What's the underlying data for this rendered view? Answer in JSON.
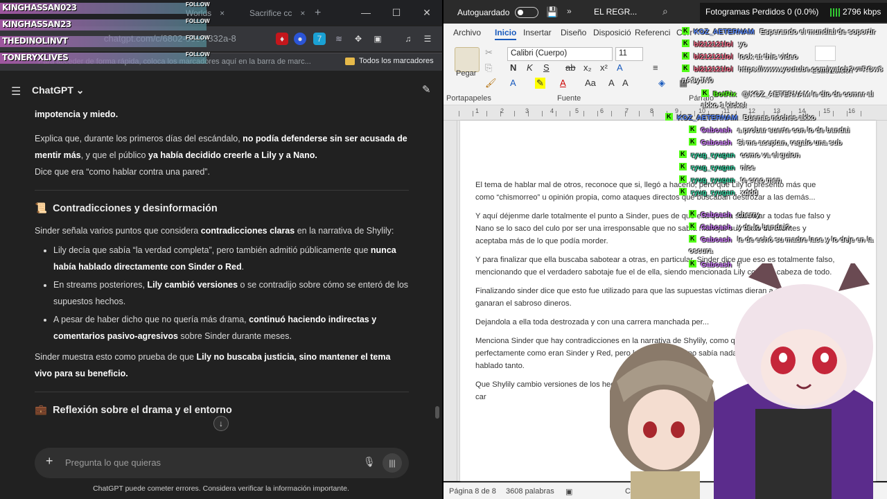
{
  "followers": [
    {
      "name": "KINGHASSAN023",
      "label": "FOLLOW"
    },
    {
      "name": "KINGHASSAN23",
      "label": "FOLLOW"
    },
    {
      "name": "THEDINOLINVT",
      "label": "FOLLOW"
    },
    {
      "name": "TONERYXLIVES",
      "label": "FOLLOW"
    }
  ],
  "browser": {
    "tabs": [
      {
        "label": "Worlds",
        "close": "×"
      },
      {
        "label": "Sacrifice cc",
        "close": "×"
      }
    ],
    "new_tab": "+",
    "window_buttons": [
      "—",
      "☐",
      "✕"
    ],
    "url": "chatgpt.com/c/6802-53c4-832a-8",
    "bookmarks_hint": "Para acceder de forma rápida, coloca los marcadores aquí en la barra de marc...",
    "all_bookmarks": "Todos los marcadores"
  },
  "chatgpt": {
    "title": "ChatGPT",
    "chevron": "⌄",
    "intro_bold": "impotencia y miedo.",
    "para1_a": "Explica que, durante los primeros días del escándalo, ",
    "para1_b": "no podía defenderse sin ser acusada de mentir más",
    "para1_c": ", y que el público ",
    "para1_d": "ya había decidido creerle a Lily y a Nano.",
    "para1_e": "Dice que era “como hablar contra una pared”.",
    "section1": {
      "emoji": "📜",
      "title": "Contradicciones y desinformación"
    },
    "section1_intro_a": "Sinder señala varios puntos que considera ",
    "section1_intro_b": "contradicciones claras",
    "section1_intro_c": " en la narrativa de Shylily:",
    "bullets": [
      {
        "a": "Lily decía que sabía “la verdad completa”, pero también admitió públicamente que ",
        "b": "nunca había hablado directamente con Sinder o Red",
        "c": "."
      },
      {
        "a": "En streams posteriores, ",
        "b": "Lily cambió versiones",
        "c": " o se contradijo sobre cómo se enteró de los supuestos hechos."
      },
      {
        "a": "A pesar de haber dicho que no quería más drama, ",
        "b": "continuó haciendo indirectas y comentarios pasivo-agresivos",
        "c": " sobre Sinder durante meses."
      }
    ],
    "closing_a": "Sinder muestra esto como prueba de que ",
    "closing_b": "Lily no buscaba justicia, sino mantener el tema vivo para su beneficio.",
    "section2": {
      "emoji": "💼",
      "title": "Reflexión sobre el drama y el entorno"
    },
    "composer_placeholder": "Pregunta lo que quieras",
    "disclaimer": "ChatGPT puede cometer errores. Considera verificar la información importante."
  },
  "word": {
    "autosave_label": "Autoguardado",
    "doc_name": "EL REGR...",
    "ribbon_tabs": [
      "Archivo",
      "Inicio",
      "Insertar",
      "Diseño",
      "Disposició",
      "Referenci",
      "Corr"
    ],
    "active_tab": "Inicio",
    "paste_label": "Pegar",
    "font_name": "Calibri (Cuerpo)",
    "font_size": "11",
    "groups": [
      "Portapapeles",
      "Fuente",
      "Párrafo",
      "Estilos",
      "Edición"
    ],
    "ruler_numbers": [
      "1",
      "2",
      "3",
      "4",
      "5",
      "6",
      "7",
      "8",
      "9",
      "10",
      "11",
      "12",
      "13",
      "14",
      "15",
      "16"
    ],
    "paragraphs": [
      "El tema de hablar mal de otros, reconoce que si, llegó a hacerlo, pero que Lily lo presento más que como “chismorreo” u opinión propia, como ataques directos que buscaban destrozar a las demás...",
      "Y aquí déjenme darle totalmente el punto a Sinder, pues de que ella quería sabotear a todas fue falso y Nano se lo saco del culo por ser una irresponsable que no sabía manejar sus listas de clientes y aceptaba más de lo que podía morder.",
      "Y para finalizar que ella buscaba sabotear a otras, en particular, Sinder dice que eso es totalmente falso, mencionando que el verdadero sabotaje fue el de ella, siendo mencionada Lily como la cabeza de todo.",
      "Finalizando sinder dice que esto fue utilizado para que las supuestas víctimas dieran a medias y ganaran el sabroso dineros.",
      "Dejandola a ella toda destrozada y con una carrera manchada per...",
      "Menciona Sinder que hay contradicciones en la narrativa de Shylily, como que ella conocía perfectamente como eran Sinder y Red, pero luego decir que no sabía nada, porque nunca habían hablado tanto.",
      "Que Shylily cambio versiones de los hechos en diferentes ver...",
      "car"
    ],
    "status_page": "Página 8 de 8",
    "status_words": "3608 palabras",
    "status_extra": "Conc"
  },
  "stream": {
    "dropped_frames": "Fotogramas Perdidos 0 (0.0%)",
    "bitrate": "2796 kbps"
  },
  "chat_messages": [
    {
      "user": "KOZ_AETERNAM",
      "text": "Esperando el mundial de soportir",
      "color": "#5b8cff"
    },
    {
      "user": "bl212121lol",
      "text": "yo",
      "color": "#ff6b8a"
    },
    {
      "user": "bl212121lol",
      "text": "look at this video",
      "color": "#ff6b8a"
    },
    {
      "user": "bl212121lol",
      "text": "https://www.youtube.com/watch?v=ROw8nA3yJN0",
      "color": "#ff6b8a"
    },
    {
      "user": "BotRix",
      "text": "@KOZ_AETERNAM le dio de comer al akko 1 kicks!",
      "color": "#53fc18"
    },
    {
      "user": "KOZ_AETERNAM",
      "text": "Buenas noches akko",
      "color": "#5b8cff"
    },
    {
      "user": "Gaboash",
      "text": "a probar suerte con lo de bandai",
      "color": "#d17cff"
    },
    {
      "user": "Gaboash",
      "text": "Si me aceptan, regalo una sub",
      "color": "#d17cff"
    },
    {
      "user": "ryug_ryugan",
      "text": "como va el guion",
      "color": "#2fd3a0"
    },
    {
      "user": "ryug_ryugan",
      "text": "nice",
      "color": "#2fd3a0"
    },
    {
      "user": "ryug_ryugan",
      "text": "te creo men",
      "color": "#2fd3a0"
    },
    {
      "user": "ryug_ryugan",
      "text": "xddd",
      "color": "#2fd3a0"
    },
    {
      "user": "Gaboash",
      "text": "cherry",
      "color": "#d17cff"
    },
    {
      "user": "Gaboash",
      "text": "y de lo bandai?",
      "color": "#d17cff"
    },
    {
      "user": "Gaboash",
      "text": "le de echó su madre lace y lo deje en la oscura",
      "color": "#d17cff"
    },
    {
      "user": "Gaboash",
      "text": "!",
      "color": "#d17cff"
    }
  ]
}
